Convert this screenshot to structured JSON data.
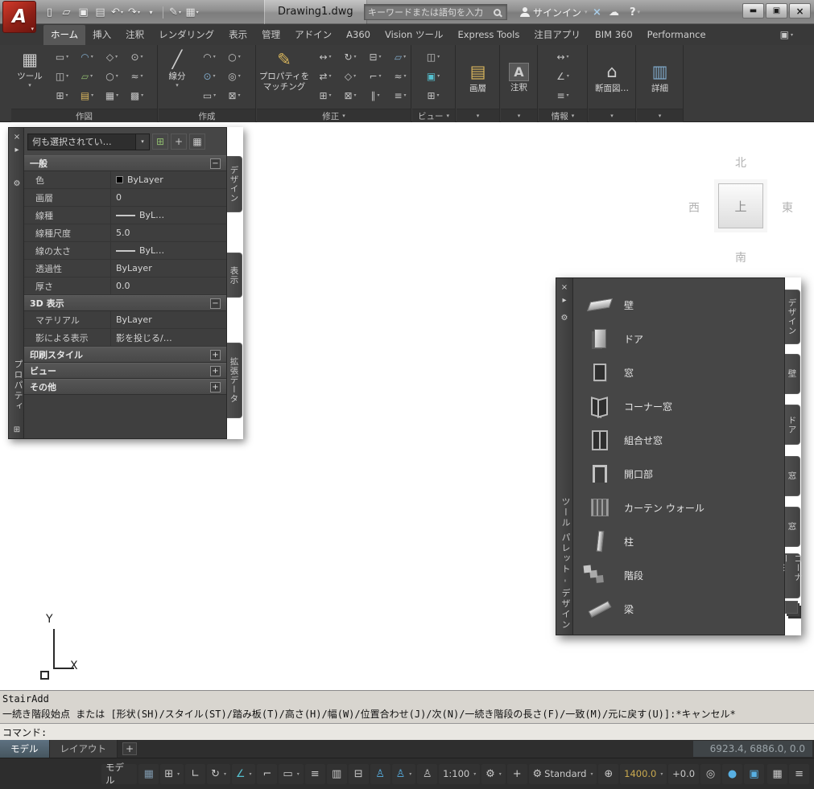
{
  "titlebar": {
    "title": "Drawing1.dwg",
    "search_placeholder": "キーワードまたは語句を入力",
    "signin_label": "サインイン"
  },
  "ribbon": {
    "tabs": [
      "ホーム",
      "挿入",
      "注釈",
      "レンダリング",
      "表示",
      "管理",
      "アドイン",
      "A360",
      "Vision ツール",
      "Express Tools",
      "注目アプリ",
      "BIM 360",
      "Performance"
    ],
    "buttons": {
      "tools": "ツール",
      "line": "線分",
      "match_properties": "プロパティをマッチング",
      "layer": "画層",
      "annotation": "注釈",
      "section": "断面図…",
      "detail": "詳細"
    },
    "panel_labels": {
      "draw": "作図",
      "create": "作成",
      "modify": "修正",
      "view": "ビュー",
      "info": "情報"
    }
  },
  "properties_palette": {
    "vertical_title": "プロパティ",
    "selection_dropdown": "何も選択されてい…",
    "sections": [
      {
        "title": "一般",
        "rows": [
          {
            "label": "色",
            "value": "ByLayer"
          },
          {
            "label": "画層",
            "value": "0"
          },
          {
            "label": "線種",
            "value": "ByL…"
          },
          {
            "label": "線種尺度",
            "value": "5.0"
          },
          {
            "label": "線の太さ",
            "value": "ByL…"
          },
          {
            "label": "透過性",
            "value": "ByLayer"
          },
          {
            "label": "厚さ",
            "value": "0.0"
          }
        ]
      },
      {
        "title": "3D 表示",
        "rows": [
          {
            "label": "マテリアル",
            "value": "ByLayer"
          },
          {
            "label": "影による表示",
            "value": "影を投じる/…"
          }
        ]
      },
      {
        "title": "印刷スタイル",
        "rows": []
      },
      {
        "title": "ビュー",
        "rows": []
      },
      {
        "title": "その他",
        "rows": []
      }
    ],
    "side_tabs": [
      "デザイン",
      "表示",
      "拡張データ"
    ]
  },
  "viewcube": {
    "north": "北",
    "west": "西",
    "top": "上",
    "east": "東",
    "south": "南"
  },
  "tool_palette": {
    "vertical_title": "ツール パレット - デザイン",
    "items": [
      {
        "label": "壁"
      },
      {
        "label": "ドア"
      },
      {
        "label": "窓"
      },
      {
        "label": "コーナー窓"
      },
      {
        "label": "組合せ窓"
      },
      {
        "label": "開口部"
      },
      {
        "label": "カーテン ウォール"
      },
      {
        "label": "柱"
      },
      {
        "label": "階段"
      },
      {
        "label": "梁"
      }
    ],
    "side_tabs": [
      "デザイン",
      "壁",
      "ドア",
      "窓",
      "窓",
      "コーナー…"
    ]
  },
  "ucs": {
    "x_label": "X",
    "y_label": "Y"
  },
  "command_line": {
    "history_1": "StairAdd",
    "history_2": "一続き階段始点 または [形状(SH)/スタイル(ST)/踏み板(T)/高さ(H)/幅(W)/位置合わせ(J)/次(N)/一続き階段の長さ(F)/一致(M)/元に戻す(U)]:*キャンセル*",
    "prompt": "コマンド:"
  },
  "layout_bar": {
    "model_tab": "モデル",
    "layout_tab": "レイアウト",
    "add_tab": "+",
    "coordinates": "6923.4, 6886.0, 0.0"
  },
  "status_bar": {
    "model_label": "モデル",
    "scale": "1:100",
    "workspace": "Standard",
    "elevation": "1400.0",
    "offset": "+0.0"
  }
}
